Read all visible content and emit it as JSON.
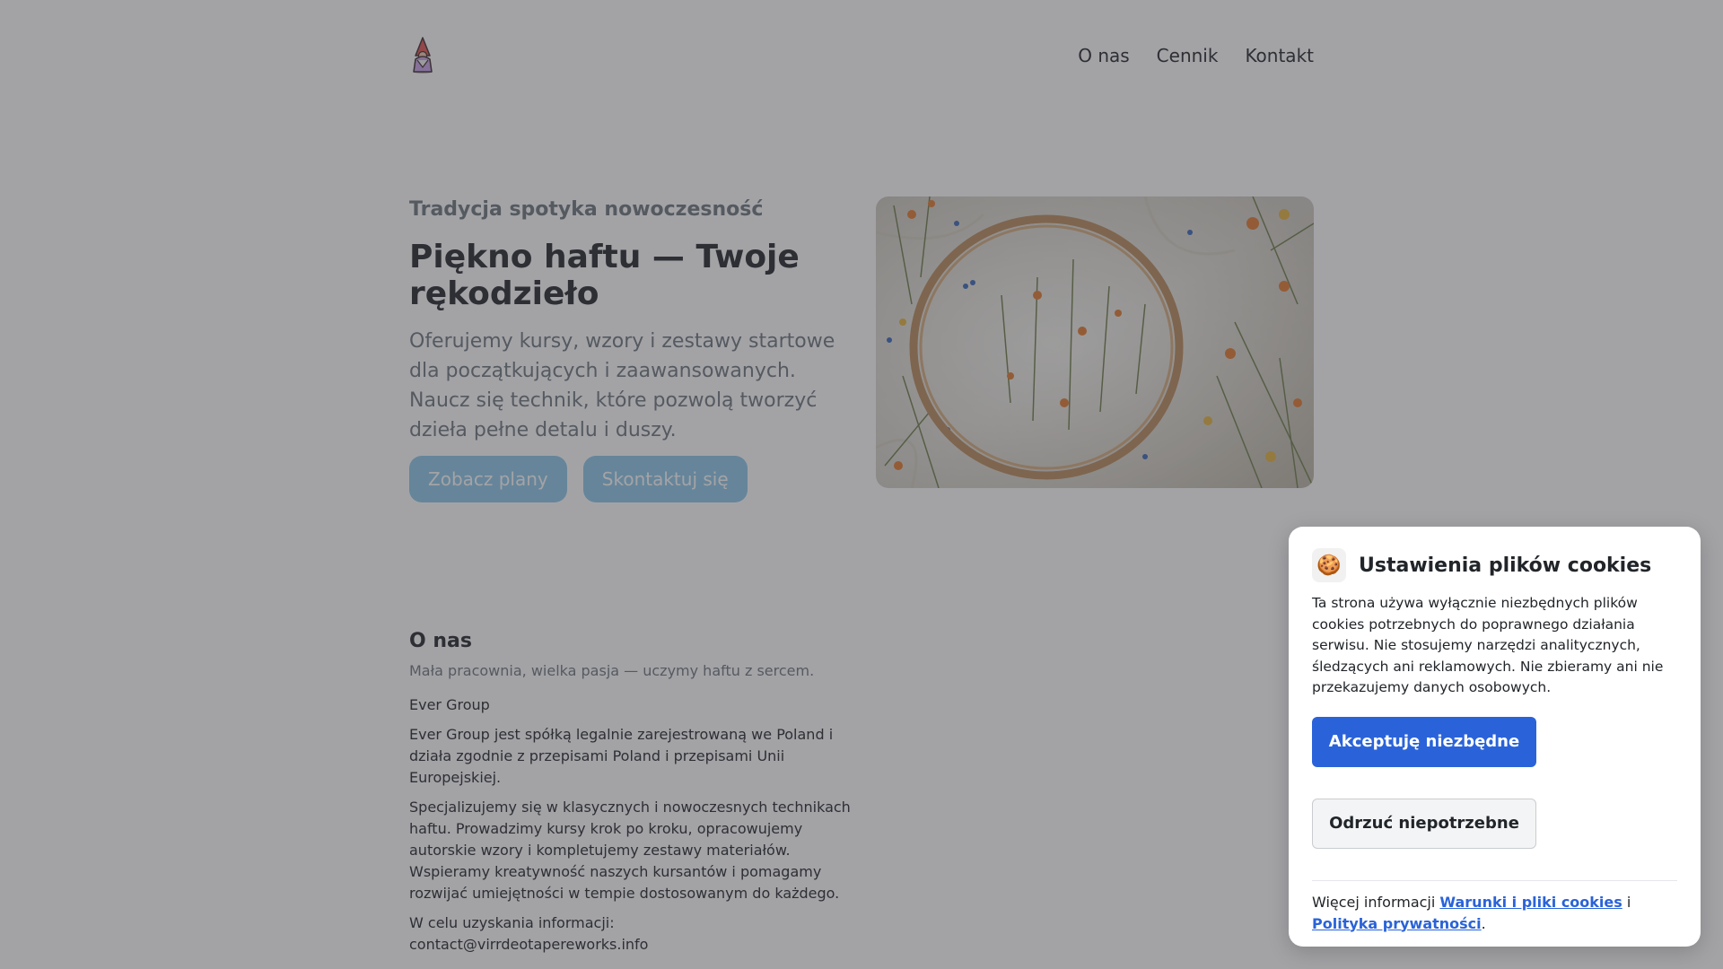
{
  "header": {
    "logo_icon": "gnome-logo-icon",
    "nav": [
      {
        "label": "O nas"
      },
      {
        "label": "Cennik"
      },
      {
        "label": "Kontakt"
      }
    ]
  },
  "hero": {
    "kicker": "Tradycja spotyka nowoczesność",
    "title": "Piękno haftu — Twoje rękodzieło",
    "description": "Oferujemy kursy, wzory i zestawy startowe dla początkujących i zaawansowanych. Naucz się technik, które pozwolą tworzyć dzieła pełne detalu i duszy.",
    "buttons": {
      "plans": "Zobacz plany",
      "contact": "Skontaktuj się"
    },
    "button_color": "#8cc6e8"
  },
  "about": {
    "title": "O nas",
    "subtitle": "Mała pracownia, wielka pasja — uczymy haftu z sercem.",
    "company": "Ever Group",
    "legal": "Ever Group jest spółką legalnie zarejestrowaną we Poland i działa zgodnie z przepisami Poland i przepisami Unii Europejskiej.",
    "description": "Specjalizujemy się w klasycznych i nowoczesnych technikach haftu. Prowadzimy kursy krok po kroku, opracowujemy autorskie wzory i kompletujemy zestawy materiałów. Wspieramy kreatywność naszych kursantów i pomagamy rozwijać umiejętności w tempie dostosowanym do każdego.",
    "contact_label": "W celu uzyskania informacji:",
    "contact_email": "contact@virrdeotapereworks.info"
  },
  "cookie": {
    "icon": "cookie-icon",
    "icon_glyph": "🍪",
    "title": "Ustawienia plików cookies",
    "text": "Ta strona używa wyłącznie niezbędnych plików cookies potrzebnych do poprawnego działania serwisu. Nie stosujemy narzędzi analitycznych, śledzących ani reklamowych. Nie zbieramy ani nie przekazujemy danych osobowych.",
    "accept_label": "Akceptuję niezbędne",
    "reject_label": "Odrzuć niepotrzebne",
    "more_prefix": "Więcej informacji",
    "terms_link": "Warunki i pliki cookies",
    "conjunction": "i",
    "privacy_link": "Polityka prywatności",
    "suffix": ".",
    "accent_color": "#2a63d9"
  }
}
